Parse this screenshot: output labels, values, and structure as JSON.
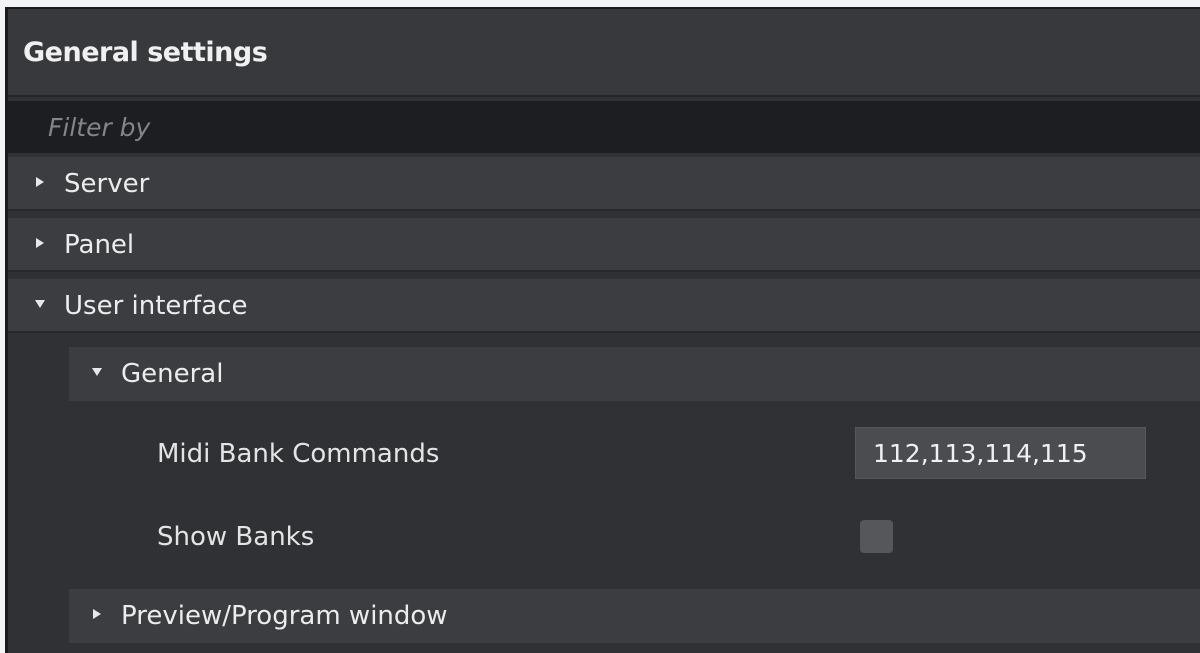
{
  "header": {
    "title": "General settings"
  },
  "filter": {
    "placeholder": "Filter by"
  },
  "sections": [
    {
      "label": "Server",
      "state": "collapsed"
    },
    {
      "label": "Panel",
      "state": "collapsed"
    },
    {
      "label": "User interface",
      "state": "expanded"
    }
  ],
  "user_interface": {
    "general": {
      "label": "General",
      "state": "expanded",
      "midi_bank_commands": {
        "label": "Midi Bank Commands",
        "value": "112,113,114,115"
      },
      "show_banks": {
        "label": "Show Banks",
        "checked": false
      }
    },
    "preview_program": {
      "label": "Preview/Program window",
      "state": "collapsed"
    }
  },
  "icons": {
    "collapsed": "triangle-right-icon",
    "expanded": "triangle-down-icon"
  },
  "colors": {
    "panel_bg": "#2f3134",
    "header_bg": "#38393c",
    "section_bg": "#3b3d40",
    "filter_bg": "#1d1e21",
    "text": "#e6e6e6"
  }
}
